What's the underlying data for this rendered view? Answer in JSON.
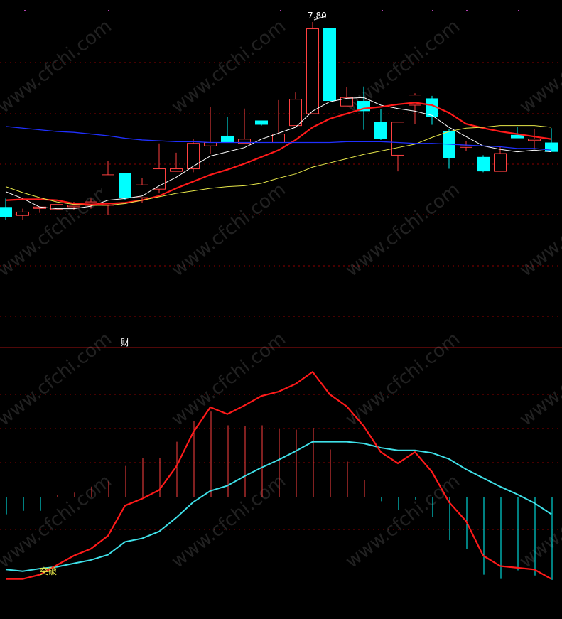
{
  "chart_data": [
    {
      "type": "candlestick",
      "title": "",
      "peak_label": "7.80",
      "watermark": "www.cfchi.com",
      "marker_label": "财",
      "colors": {
        "up": "#ff4040",
        "down": "#00ffff",
        "ma_white": "#ffffff",
        "ma_red": "#ff1a1a",
        "ma_yellow": "#e8e84a",
        "ma_blue": "#2030ff",
        "grid": "#8b0000"
      },
      "price_range": [
        4.5,
        7.85
      ],
      "candles": [
        {
          "o": 5.62,
          "h": 5.72,
          "l": 5.47,
          "c": 5.5
        },
        {
          "o": 5.52,
          "h": 5.6,
          "l": 5.47,
          "c": 5.56
        },
        {
          "o": 5.62,
          "h": 5.62,
          "l": 5.55,
          "c": 5.62
        },
        {
          "o": 5.59,
          "h": 5.65,
          "l": 5.59,
          "c": 5.65
        },
        {
          "o": 5.64,
          "h": 5.68,
          "l": 5.58,
          "c": 5.64
        },
        {
          "o": 5.64,
          "h": 5.72,
          "l": 5.6,
          "c": 5.68
        },
        {
          "o": 5.64,
          "h": 6.16,
          "l": 5.53,
          "c": 6.0
        },
        {
          "o": 6.02,
          "h": 6.02,
          "l": 5.7,
          "c": 5.73
        },
        {
          "o": 5.73,
          "h": 5.96,
          "l": 5.67,
          "c": 5.88
        },
        {
          "o": 5.83,
          "h": 6.37,
          "l": 5.78,
          "c": 6.07
        },
        {
          "o": 6.04,
          "h": 6.26,
          "l": 6.04,
          "c": 6.07
        },
        {
          "o": 6.07,
          "h": 6.42,
          "l": 6.03,
          "c": 6.37
        },
        {
          "o": 6.34,
          "h": 6.8,
          "l": 6.25,
          "c": 6.38
        },
        {
          "o": 6.46,
          "h": 6.68,
          "l": 6.46,
          "c": 6.38
        },
        {
          "o": 6.37,
          "h": 6.78,
          "l": 6.37,
          "c": 6.42
        },
        {
          "o": 6.64,
          "h": 6.64,
          "l": 6.58,
          "c": 6.59
        },
        {
          "o": 6.38,
          "h": 6.88,
          "l": 6.38,
          "c": 6.48
        },
        {
          "o": 6.58,
          "h": 6.97,
          "l": 6.58,
          "c": 6.89
        },
        {
          "o": 6.72,
          "h": 7.8,
          "l": 6.72,
          "c": 7.72
        },
        {
          "o": 7.73,
          "h": 7.73,
          "l": 6.87,
          "c": 6.87
        },
        {
          "o": 6.81,
          "h": 7.03,
          "l": 6.81,
          "c": 6.91
        },
        {
          "o": 6.87,
          "h": 7.04,
          "l": 6.53,
          "c": 6.75
        },
        {
          "o": 6.62,
          "h": 6.77,
          "l": 6.41,
          "c": 6.42
        },
        {
          "o": 6.23,
          "h": 6.49,
          "l": 6.04,
          "c": 6.62
        },
        {
          "o": 6.82,
          "h": 6.96,
          "l": 6.6,
          "c": 6.94
        },
        {
          "o": 6.9,
          "h": 6.93,
          "l": 6.59,
          "c": 6.68
        },
        {
          "o": 6.51,
          "h": 6.54,
          "l": 6.07,
          "c": 6.2
        },
        {
          "o": 6.34,
          "h": 6.4,
          "l": 6.28,
          "c": 6.34
        },
        {
          "o": 6.21,
          "h": 6.23,
          "l": 6.03,
          "c": 6.04
        },
        {
          "o": 6.04,
          "h": 6.33,
          "l": 6.04,
          "c": 6.25
        },
        {
          "o": 6.47,
          "h": 6.56,
          "l": 6.47,
          "c": 6.43
        },
        {
          "o": 6.41,
          "h": 6.54,
          "l": 6.31,
          "c": 6.42
        },
        {
          "o": 6.38,
          "h": 6.55,
          "l": 6.38,
          "c": 6.27
        }
      ],
      "moving_averages": {
        "white": [
          5.8,
          5.72,
          5.62,
          5.6,
          5.6,
          5.63,
          5.7,
          5.72,
          5.75,
          5.87,
          5.97,
          6.1,
          6.22,
          6.27,
          6.32,
          6.42,
          6.49,
          6.56,
          6.75,
          6.86,
          6.9,
          6.91,
          6.82,
          6.78,
          6.75,
          6.7,
          6.56,
          6.45,
          6.34,
          6.3,
          6.27,
          6.29,
          6.27
        ],
        "red": [
          5.7,
          5.71,
          5.71,
          5.7,
          5.66,
          5.65,
          5.66,
          5.67,
          5.7,
          5.75,
          5.84,
          5.92,
          6.0,
          6.06,
          6.13,
          6.21,
          6.29,
          6.41,
          6.56,
          6.66,
          6.72,
          6.78,
          6.8,
          6.83,
          6.85,
          6.82,
          6.73,
          6.6,
          6.55,
          6.51,
          6.48,
          6.45,
          6.42
        ],
        "yellow": [
          5.86,
          5.79,
          5.73,
          5.68,
          5.65,
          5.64,
          5.64,
          5.66,
          5.7,
          5.74,
          5.78,
          5.81,
          5.84,
          5.86,
          5.87,
          5.9,
          5.96,
          6.01,
          6.09,
          6.14,
          6.19,
          6.24,
          6.28,
          6.32,
          6.36,
          6.44,
          6.51,
          6.55,
          6.56,
          6.58,
          6.58,
          6.58,
          6.56
        ],
        "blue": [
          6.57,
          6.55,
          6.53,
          6.51,
          6.5,
          6.48,
          6.46,
          6.43,
          6.41,
          6.4,
          6.39,
          6.39,
          6.38,
          6.38,
          6.38,
          6.38,
          6.38,
          6.38,
          6.38,
          6.38,
          6.39,
          6.39,
          6.39,
          6.38,
          6.37,
          6.37,
          6.36,
          6.35,
          6.34,
          6.33,
          6.31,
          6.31,
          6.29
        ]
      }
    },
    {
      "type": "line",
      "series_type": "macd",
      "annotation": "突破",
      "ylim": [
        -1.2,
        1.6
      ],
      "colors": {
        "fast": "#ff1a1a",
        "slow": "#3fe0e8",
        "hist_pos": "#ff4040",
        "hist_neg": "#00ffff"
      },
      "fast": [
        -0.95,
        -0.95,
        -0.9,
        -0.79,
        -0.68,
        -0.6,
        -0.45,
        -0.1,
        -0.02,
        0.08,
        0.35,
        0.75,
        1.04,
        0.96,
        1.06,
        1.17,
        1.22,
        1.31,
        1.45,
        1.19,
        1.05,
        0.82,
        0.52,
        0.39,
        0.52,
        0.29,
        -0.06,
        -0.28,
        -0.68,
        -0.8,
        -0.82,
        -0.84,
        -0.95
      ],
      "slow": [
        -0.84,
        -0.86,
        -0.83,
        -0.81,
        -0.77,
        -0.73,
        -0.67,
        -0.52,
        -0.48,
        -0.4,
        -0.24,
        -0.06,
        0.07,
        0.13,
        0.24,
        0.34,
        0.43,
        0.53,
        0.64,
        0.64,
        0.64,
        0.62,
        0.57,
        0.54,
        0.54,
        0.51,
        0.44,
        0.32,
        0.22,
        0.12,
        0.03,
        -0.07,
        -0.2
      ],
      "histogram": [
        -0.2,
        -0.16,
        -0.16,
        0.02,
        0.05,
        0.12,
        0.18,
        0.36,
        0.45,
        0.45,
        0.64,
        0.88,
        0.99,
        0.83,
        0.82,
        0.83,
        0.79,
        0.78,
        0.8,
        0.55,
        0.41,
        0.2,
        -0.05,
        -0.15,
        -0.03,
        -0.23,
        -0.5,
        -0.6,
        -0.9,
        -0.95,
        -0.85,
        -0.91,
        -0.96
      ]
    }
  ]
}
